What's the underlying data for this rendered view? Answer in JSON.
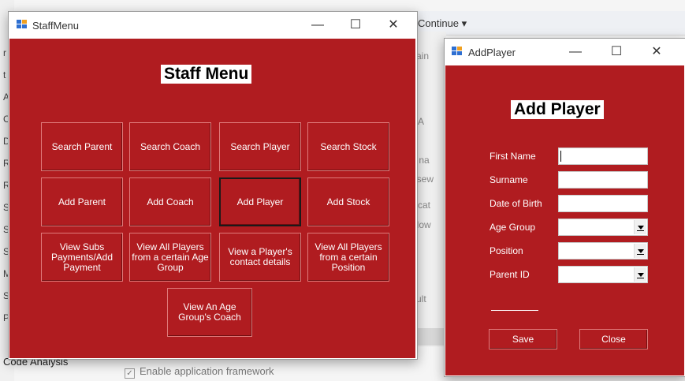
{
  "ide": {
    "continue_label": "Continue ▾",
    "left_letters": [
      "r",
      "t",
      "A",
      "C",
      "D",
      "R",
      "R",
      "S",
      "S",
      "S",
      "M",
      "S",
      "P"
    ],
    "panel_rows": [
      "Main",
      "N/A",
      "ot na",
      "ursew",
      "plicat",
      "ndow",
      "n:",
      "fault"
    ],
    "code_analysis": "Code Analysis",
    "enable_framework": "Enable application framework"
  },
  "staff_window": {
    "title": "StaffMenu",
    "heading": "Staff Menu",
    "buttons": [
      {
        "id": "search-parent",
        "label": "Search Parent"
      },
      {
        "id": "search-coach",
        "label": "Search Coach"
      },
      {
        "id": "search-player",
        "label": "Search Player"
      },
      {
        "id": "search-stock",
        "label": "Search Stock"
      },
      {
        "id": "add-parent",
        "label": "Add Parent"
      },
      {
        "id": "add-coach",
        "label": "Add Coach"
      },
      {
        "id": "add-player",
        "label": "Add Player"
      },
      {
        "id": "add-stock",
        "label": "Add Stock"
      },
      {
        "id": "view-subs",
        "label": "View Subs Payments/Add Payment"
      },
      {
        "id": "view-all-players-age",
        "label": "View All Players from a certain Age Group"
      },
      {
        "id": "view-player-contact",
        "label": "View a Player's contact details"
      },
      {
        "id": "view-all-players-position",
        "label": "View All Players from a certain Position"
      },
      {
        "id": "view-age-group-coach",
        "label": "View An Age Group's Coach"
      }
    ]
  },
  "add_player_window": {
    "title": "AddPlayer",
    "heading": "Add Player",
    "fields": [
      {
        "label": "First Name",
        "type": "text",
        "value": ""
      },
      {
        "label": "Surname",
        "type": "text",
        "value": ""
      },
      {
        "label": "Date of Birth",
        "type": "text",
        "value": ""
      },
      {
        "label": "Age Group",
        "type": "combo",
        "value": ""
      },
      {
        "label": "Position",
        "type": "combo",
        "value": ""
      },
      {
        "label": "Parent ID",
        "type": "combo",
        "value": ""
      }
    ],
    "save_label": "Save",
    "close_label": "Close"
  },
  "colors": {
    "form_background": "#b01c20",
    "heading_background": "#ffffff"
  }
}
